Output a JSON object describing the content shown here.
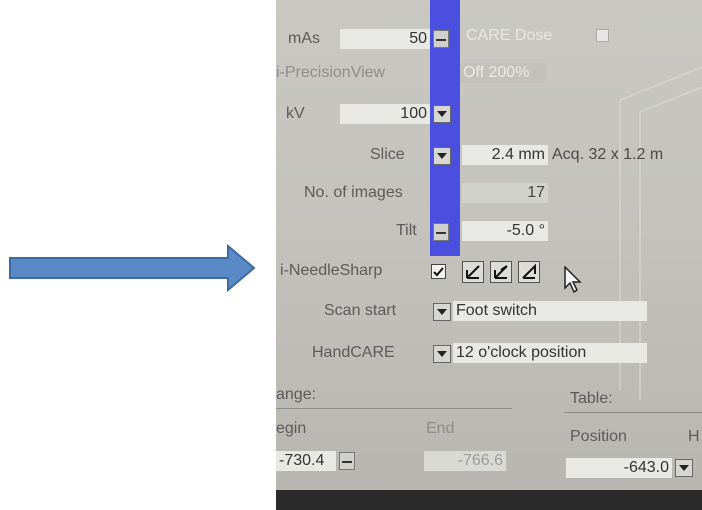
{
  "arrow": {
    "color": "#5a8ac6"
  },
  "accent_color": "#4a4fe0",
  "params": {
    "mas_label": "mAs",
    "mas_value": "50",
    "care_dose_label": "CARE Dose",
    "precision_label": "i-PrecisionView",
    "precision_value": "Off 200%",
    "kv_label": "kV",
    "kv_value": "100",
    "slice_label": "Slice",
    "slice_value": "2.4 mm",
    "acq_text": "Acq. 32 x 1.2 m",
    "images_label": "No. of images",
    "images_value": "17",
    "tilt_label": "Tilt",
    "tilt_value": "-5.0 °",
    "needle_label": "i-NeedleSharp",
    "scanstart_label": "Scan start",
    "scanstart_value": "Foot switch",
    "handcare_label": "HandCARE",
    "handcare_value": "12 o'clock position"
  },
  "range": {
    "label": "ange:",
    "begin_label": "egin",
    "end_label": "End",
    "begin_value": "-730.4",
    "end_value": "-766.6"
  },
  "table": {
    "label": "Table:",
    "position_label": "Position",
    "position_value": "-643.0",
    "extra_label": "H"
  }
}
